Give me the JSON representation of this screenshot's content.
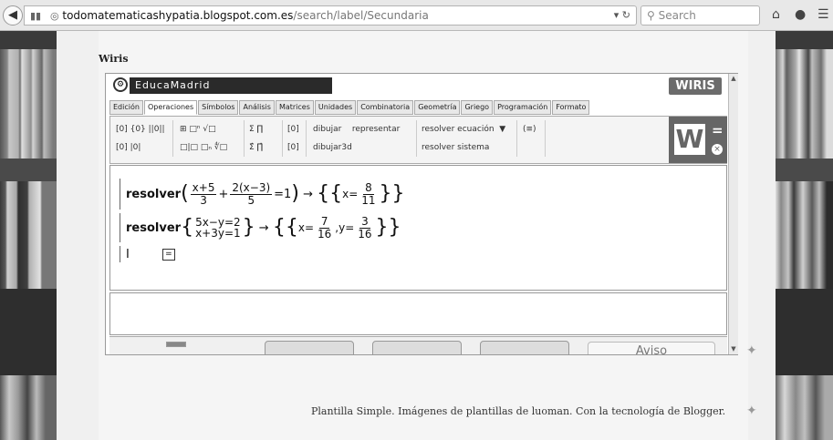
{
  "browser": {
    "url_host": "todomatematicashypatia.blogspot.com.es",
    "url_path": "/search/label/Secundaria",
    "search_placeholder": "Search"
  },
  "page": {
    "post_title": "Wiris",
    "footer": "Plantilla Simple. Imágenes de plantillas de luoman. Con la tecnología de Blogger."
  },
  "wiris": {
    "brand": "EducaMadrid",
    "logo_text": "WIRIS",
    "tabs": [
      "Edición",
      "Operaciones",
      "Símbolos",
      "Análisis",
      "Matrices",
      "Unidades",
      "Combinatoria",
      "Geometría",
      "Griego",
      "Programación",
      "Formato"
    ],
    "active_tab": "Operaciones",
    "toolbar": {
      "row1_symbols": "[0]  {0}  ||0||",
      "row2_symbols": "[0]  |0|",
      "frac_row1": "⊞  □ⁿ  √□",
      "frac_row2": "□|□  □ₙ  ∜□",
      "sum_row1": "Σ  ∏",
      "sum_row2": "Σ̂  ∏̂",
      "bracket1": "[0]",
      "bracket2": "[0]",
      "dibujar": "dibujar",
      "representar": "representar",
      "dibujar3d": "dibujar3d",
      "resolver_ecuacion": "resolver ecuación",
      "resolver_sistema": "resolver sistema",
      "matrix_symbol": "(≡)",
      "calc_button": "W",
      "equals_symbol": "=",
      "close_symbol": "×"
    },
    "formula": {
      "line1": {
        "keyword": "resolver",
        "frac1_num": "x+5",
        "frac1_den": "3",
        "plus": "+",
        "frac2_num": "2(x−3)",
        "frac2_den": "5",
        "rhs": "=1",
        "arrow": "→",
        "result_var": "x=",
        "result_num": "8",
        "result_den": "11"
      },
      "line2": {
        "keyword": "resolver",
        "eq1": "5x−y=2",
        "eq2": "x+3y=1",
        "arrow": "→",
        "res_x": "x=",
        "res_x_num": "7",
        "res_x_den": "16",
        "comma_y": ",y=",
        "res_y_num": "3",
        "res_y_den": "16"
      },
      "line3_cursor": "I",
      "line3_box": "="
    },
    "bottom_aviso": "Aviso"
  },
  "colors": {
    "chrome_bg": "#e8e8e8",
    "wiris_dark": "#2a2a2a",
    "wiris_gray": "#666666"
  }
}
